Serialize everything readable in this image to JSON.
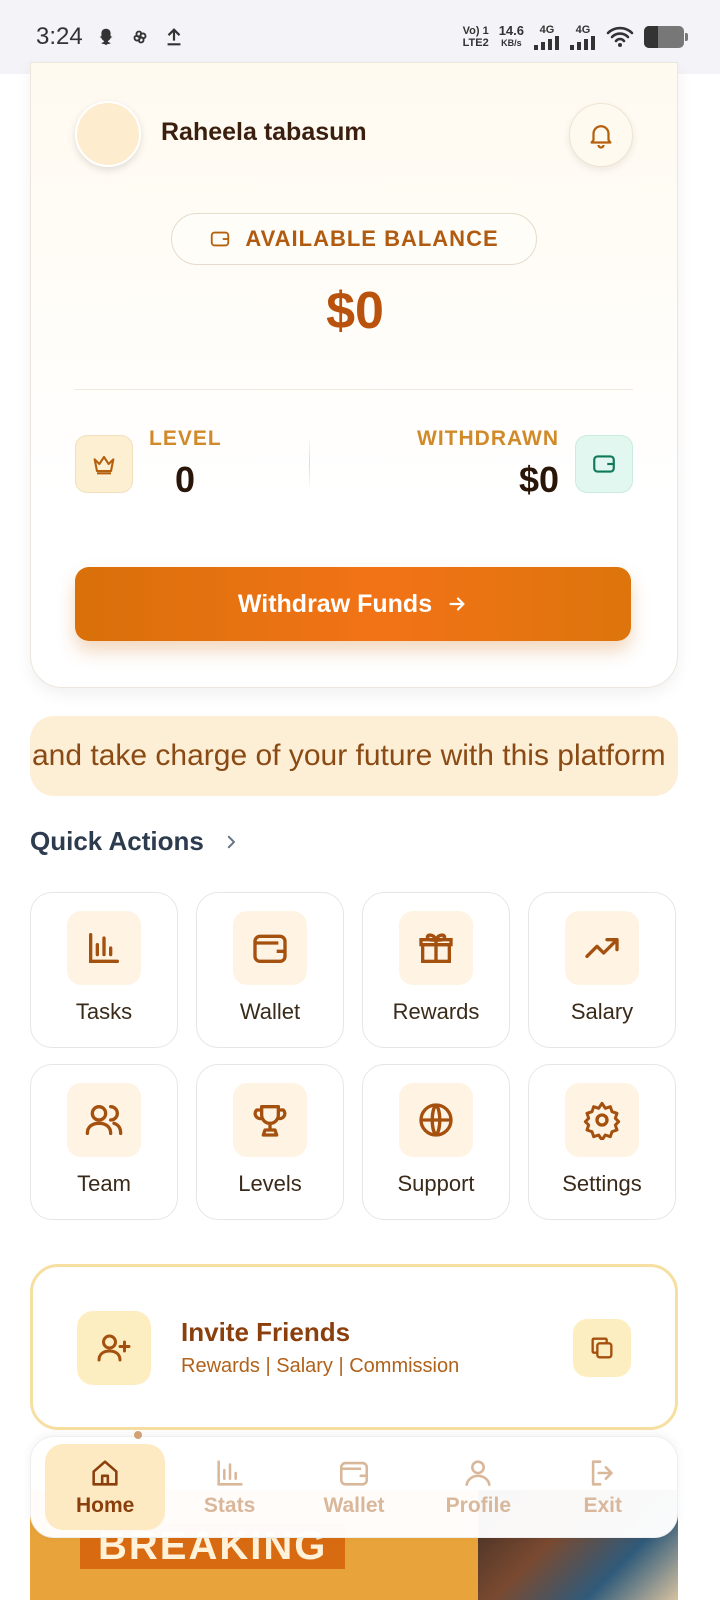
{
  "status_bar": {
    "time": "3:24",
    "network_top": "Vo) 1",
    "network_bottom": "LTE2",
    "speed_value": "14.6",
    "speed_unit": "KB/s",
    "sim1": "4G",
    "sim2": "4G"
  },
  "profile": {
    "name": "Raheela tabasum"
  },
  "balance": {
    "label": "AVAILABLE BALANCE",
    "value": "$0"
  },
  "stats": {
    "level_label": "LEVEL",
    "level_value": "0",
    "withdrawn_label": "WITHDRAWN",
    "withdrawn_value": "$0"
  },
  "withdraw_button": {
    "label": "Withdraw Funds"
  },
  "ticker": {
    "text": "and take charge of your future with this platform"
  },
  "quick_actions": {
    "title": "Quick Actions",
    "items": [
      {
        "label": "Tasks",
        "icon": "bar-chart-icon"
      },
      {
        "label": "Wallet",
        "icon": "wallet-icon"
      },
      {
        "label": "Rewards",
        "icon": "gift-icon"
      },
      {
        "label": "Salary",
        "icon": "trending-up-icon"
      },
      {
        "label": "Team",
        "icon": "users-icon"
      },
      {
        "label": "Levels",
        "icon": "trophy-icon"
      },
      {
        "label": "Support",
        "icon": "globe-icon"
      },
      {
        "label": "Settings",
        "icon": "gear-icon"
      }
    ]
  },
  "invite": {
    "title": "Invite Friends",
    "subtitle": "Rewards | Salary | Commission"
  },
  "banner": {
    "text": "BREAKING"
  },
  "bottom_nav": {
    "items": [
      {
        "label": "Home",
        "active": true
      },
      {
        "label": "Stats",
        "active": false
      },
      {
        "label": "Wallet",
        "active": false
      },
      {
        "label": "Profile",
        "active": false
      },
      {
        "label": "Exit",
        "active": false
      }
    ]
  },
  "colors": {
    "accent": "#f27316",
    "brand_brown": "#8a3f0c",
    "highlight": "#fdeac3"
  }
}
